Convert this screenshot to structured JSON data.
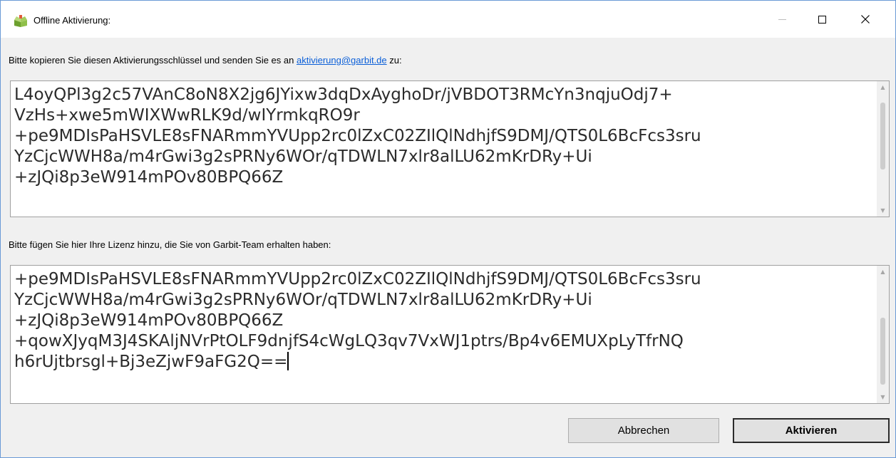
{
  "window": {
    "title": "Offline Aktivierung:",
    "minimize_label": "Minimieren",
    "maximize_label": "Maximieren",
    "close_label": "✕"
  },
  "instructions": {
    "copy_prefix": "Bitte kopieren Sie diesen Aktivierungsschlüssel und senden Sie es an ",
    "email_link": "aktivierung@garbit.de",
    "copy_suffix": " zu:",
    "license_label": "Bitte fügen Sie hier Ihre Lizenz hinzu, die Sie von Garbit-Team erhalten haben:"
  },
  "activation_key": {
    "text": "L4oyQPl3g2c57VAnC8oN8X2jg6JYixw3dqDxAyghoDr/jVBDOT3RMcYn3nqjuOdj7+\nVzHs+xwe5mWIXWwRLK9d/wIYrmkqRO9r\n+pe9MDIsPaHSVLE8sFNARmmYVUpp2rc0lZxC02ZIlQlNdhjfS9DMJ/QTS0L6BcFcs3sru\nYzCjcWWH8a/m4rGwi3g2sPRNy6WOr/qTDWLN7xlr8alLU62mKrDRy+Ui\n+zJQi8p3eW914mPOv80BPQ66Z"
  },
  "license": {
    "text": "+pe9MDIsPaHSVLE8sFNARmmYVUpp2rc0lZxC02ZIlQlNdhjfS9DMJ/QTS0L6BcFcs3sru\nYzCjcWWH8a/m4rGwi3g2sPRNy6WOr/qTDWLN7xlr8alLU62mKrDRy+Ui\n+zJQi8p3eW914mPOv80BPQ66Z\n+qowXJyqM3J4SKAljNVrPtOLF9dnjfS4cWgLQ3qv7VxWJ1ptrs/Bp4v6EMUXpLyTfrNQ\nh6rUjtbrsgl+Bj3eZjwF9aFG2Q=="
  },
  "buttons": {
    "cancel": "Abbrechen",
    "activate": "Aktivieren"
  },
  "colors": {
    "link": "#0b5fd8",
    "border": "#6a9ad6"
  }
}
